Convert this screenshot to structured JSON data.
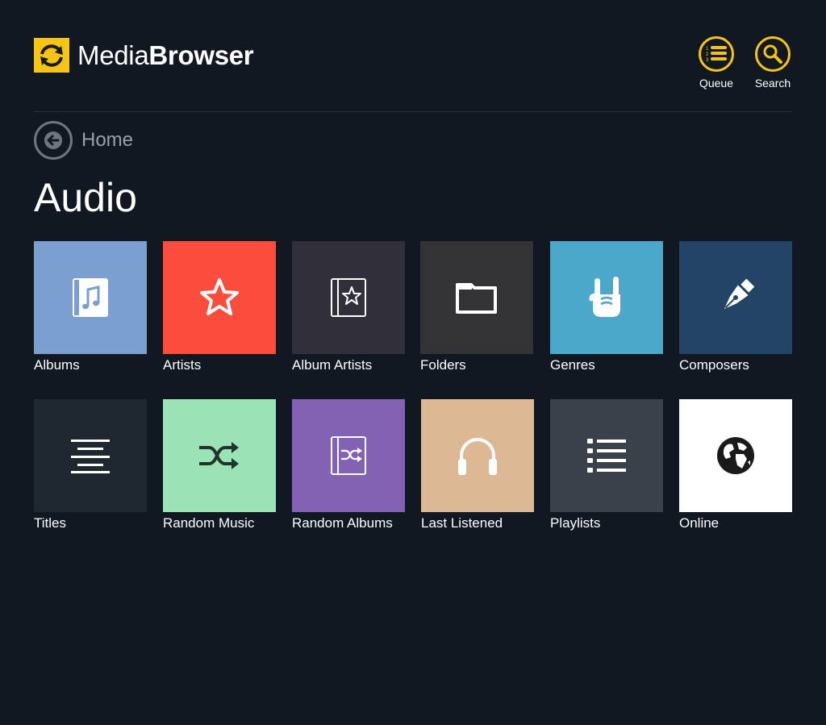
{
  "app": {
    "logo_part1": "Media",
    "logo_part2": "Browser",
    "brand_color": "#f6c415"
  },
  "header": {
    "queue_label": "Queue",
    "search_label": "Search"
  },
  "nav": {
    "back_label": "Home"
  },
  "page": {
    "title": "Audio"
  },
  "tiles": [
    {
      "label": "Albums",
      "color": "#7b9fd0",
      "icon": "music-note-book-icon"
    },
    {
      "label": "Artists",
      "color": "#fb4c3c",
      "icon": "star-icon"
    },
    {
      "label": "Album Artists",
      "color": "#302f3a",
      "icon": "star-book-icon"
    },
    {
      "label": "Folders",
      "color": "#333336",
      "icon": "folder-icon"
    },
    {
      "label": "Genres",
      "color": "#4ba8cb",
      "icon": "rock-hand-icon"
    },
    {
      "label": "Composers",
      "color": "#234465",
      "icon": "fountain-pen-icon"
    },
    {
      "label": "Titles",
      "color": "#1f2731",
      "icon": "lines-icon"
    },
    {
      "label": "Random Music",
      "color": "#99e3b7",
      "icon": "shuffle-icon"
    },
    {
      "label": "Random Albums",
      "color": "#8361b3",
      "icon": "shuffle-book-icon"
    },
    {
      "label": "Last Listened",
      "color": "#dcb994",
      "icon": "headphones-icon"
    },
    {
      "label": "Playlists",
      "color": "#3a414b",
      "icon": "list-icon"
    },
    {
      "label": "Online",
      "color": "#ffffff",
      "icon": "globe-icon"
    }
  ]
}
